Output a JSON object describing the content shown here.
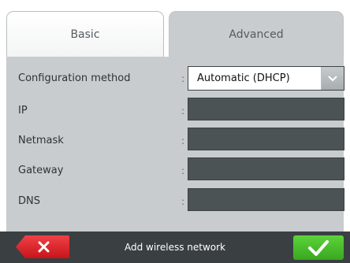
{
  "tabs": [
    {
      "label": "Basic",
      "active": false
    },
    {
      "label": "Advanced",
      "active": true
    }
  ],
  "form": {
    "config_label": "Configuration method",
    "config_value": "Automatic (DHCP)",
    "ip_label": "IP",
    "netmask_label": "Netmask",
    "gateway_label": "Gateway",
    "dns_label": "DNS",
    "separator": ":"
  },
  "footer": {
    "title": "Add wireless network"
  },
  "icons": {
    "cancel": "close-icon",
    "confirm": "checkmark-icon",
    "dropdown": "chevron-down-icon"
  },
  "colors": {
    "panel": "#c8ccce",
    "field": "#4c5354",
    "footer": "#3a3f42",
    "cancel": "#d8292f",
    "confirm": "#4cc22b"
  }
}
